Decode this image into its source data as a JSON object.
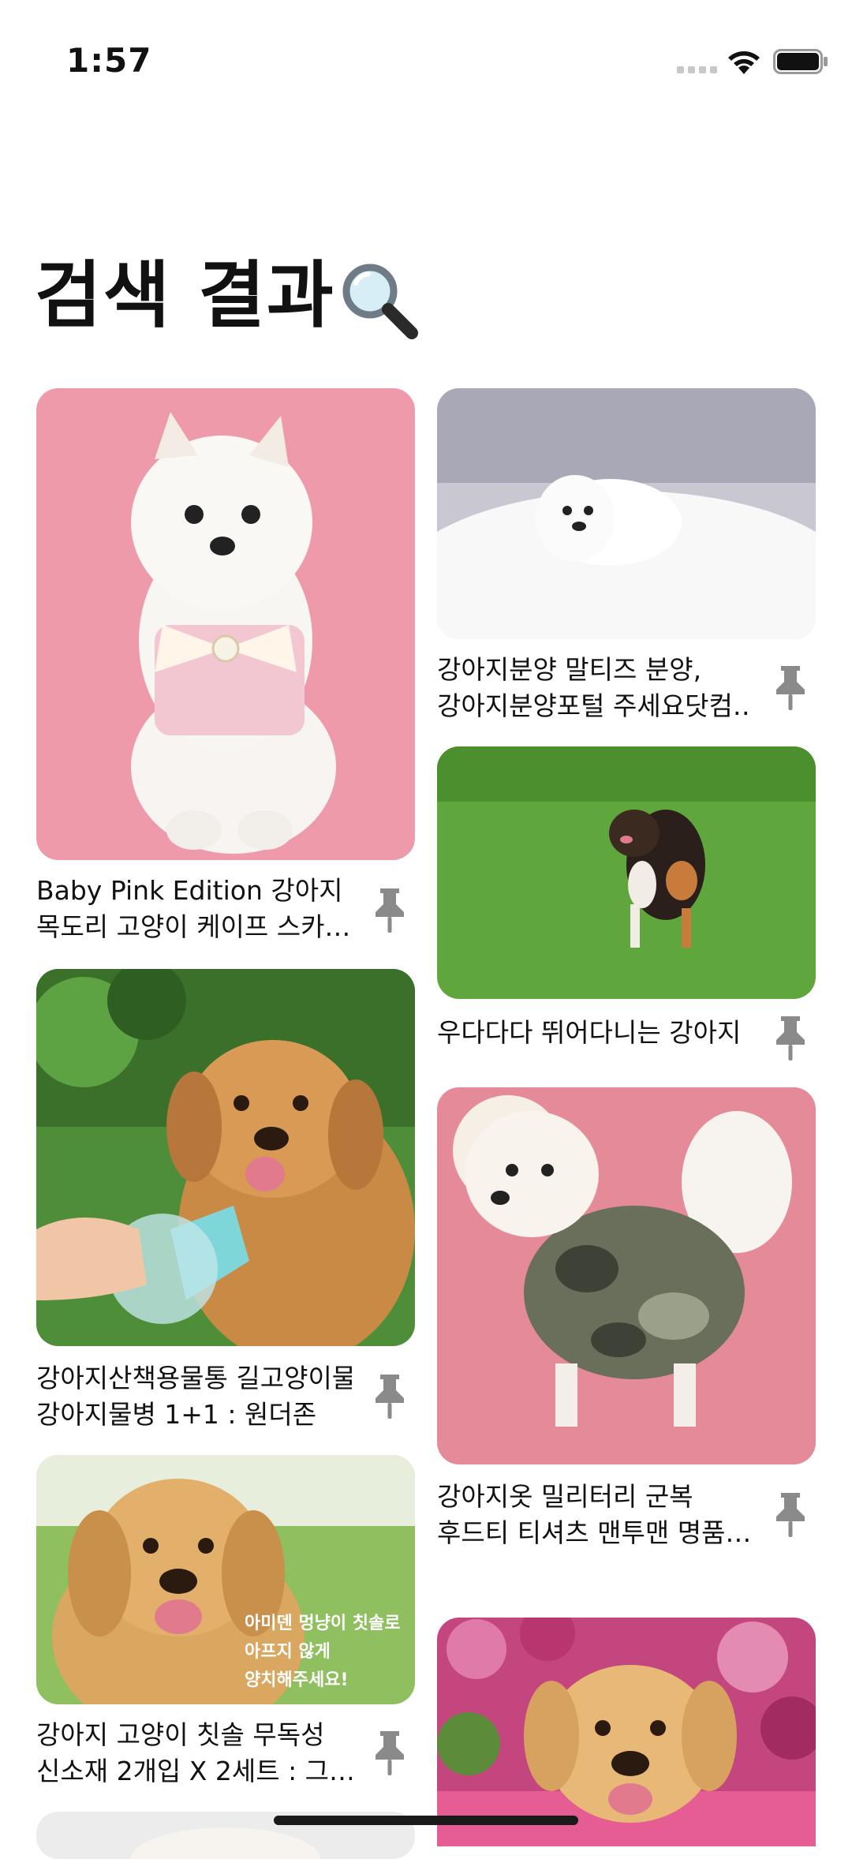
{
  "status_bar": {
    "time": "1:57"
  },
  "page": {
    "title": "검색 결과"
  },
  "left_column": [
    {
      "line1": "Baby Pink Edition 강아지",
      "line2": "목도리 고양이 케이프 스카…"
    },
    {
      "line1": "강아지산책용물통 길고양이물",
      "line2": "강아지물병 1+1 : 원더존"
    },
    {
      "line1": "강아지 고양이 칫솔 무독성",
      "line2": "신소재 2개입 X 2세트 : 그…",
      "image_text": [
        "아미덴 멍냥이 칫솔로",
        "아프지 않게",
        "양치해주세요!"
      ]
    }
  ],
  "right_column": [
    {
      "line1": "강아지분양 말티즈 분양,",
      "line2": "강아지분양포털 주세요닷컴…"
    },
    {
      "line1": "우다다다 뛰어다니는 강아지",
      "line2": ""
    },
    {
      "line1": "강아지옷 밀리터리 군복",
      "line2": "후드티 티셔츠 맨투맨 명품…"
    }
  ],
  "icons": {
    "search": "magnifier-icon",
    "pin": "pin-icon"
  },
  "colors": {
    "pin": "#8a8a8a",
    "pink_bg": "#ee9aab",
    "grass": "#5fa63c"
  }
}
